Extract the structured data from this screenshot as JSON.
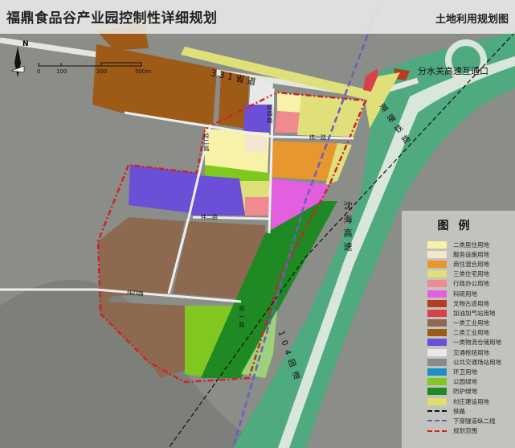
{
  "header": {
    "title": "福鼎食品谷产业园控制性详细规划",
    "subtitle": "土地利用规划图"
  },
  "scale_bar": {
    "north": "N",
    "ticks": [
      "0",
      "100",
      "300",
      "500m"
    ]
  },
  "map_labels": {
    "provincial_road": "3 3 1 省 道",
    "interchange": "分水关高速互通口",
    "railway": "温福铁路",
    "expressway": "沈海高速",
    "national_road": "104国道",
    "road_wei1": "纬一路",
    "road_wei2": "纬二路",
    "road_wei4": "纬四路",
    "road_jing4": "经四路",
    "road_jing2": "经二路",
    "road_jing1": "经一路"
  },
  "legend": {
    "title": "图例",
    "items": [
      {
        "label": "二类居住用地",
        "color": "#f7f2a8"
      },
      {
        "label": "服务设施用地",
        "color": "#f6e6cf"
      },
      {
        "label": "商住混合用地",
        "color": "#e8962e"
      },
      {
        "label": "三类住宅用地",
        "color": "#dfe07a"
      },
      {
        "label": "行政办公用地",
        "color": "#f08a8e"
      },
      {
        "label": "科研用地",
        "color": "#e35fe0"
      },
      {
        "label": "文物古迹用地",
        "color": "#b63b23"
      },
      {
        "label": "加油加气站用地",
        "color": "#d8404a"
      },
      {
        "label": "一类工业用地",
        "color": "#8d6a4f"
      },
      {
        "label": "二类工业用地",
        "color": "#9e5a17"
      },
      {
        "label": "一类物流仓储用地",
        "color": "#6b4fd6"
      },
      {
        "label": "交通枢纽用地",
        "color": "#e8e8e8"
      },
      {
        "label": "公共交通场站用地",
        "color": "#8a8a8a"
      },
      {
        "label": "环卫用地",
        "color": "#1c8fc0"
      },
      {
        "label": "公园绿地",
        "color": "#80c820"
      },
      {
        "label": "防护绿地",
        "color": "#1f8a24"
      },
      {
        "label": "村庄建设用地",
        "color": "#e0df6e"
      }
    ],
    "lines": [
      {
        "label": "铁路",
        "color": "#111111"
      },
      {
        "label": "下穿隧道纵二线",
        "color": "#6a5fc0"
      },
      {
        "label": "规划范围",
        "color": "#d0222a"
      }
    ]
  }
}
